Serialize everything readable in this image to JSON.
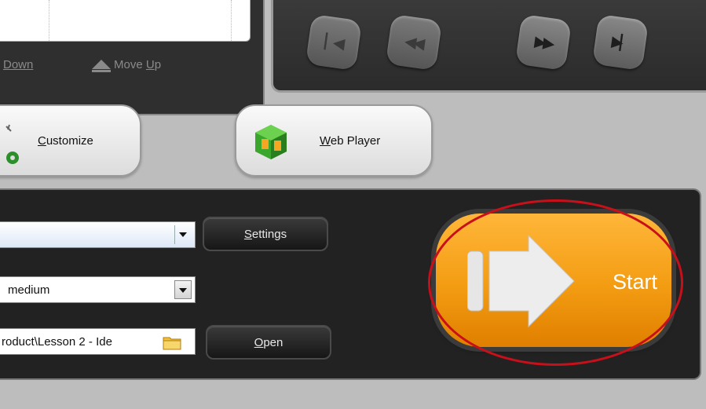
{
  "list_panel": {
    "move_down_label": "Down",
    "move_up_label_pre": "Move ",
    "move_up_label_key": "U",
    "move_up_label_post": "p"
  },
  "player": {
    "buttons": [
      "previous-track",
      "rewind",
      "fast-forward",
      "next-track"
    ]
  },
  "actions": {
    "customize_key": "C",
    "customize_rest": "ustomize",
    "web_player_key": "W",
    "web_player_rest": "eb Player"
  },
  "settings": {
    "format_value": "",
    "settings_key": "S",
    "settings_rest": "ettings",
    "quality_value": "medium",
    "output_path": "roduct\\Lesson 2 - Ide",
    "open_key": "O",
    "open_rest": "pen"
  },
  "start": {
    "label": "Start"
  },
  "colors": {
    "accent_orange": "#f39c12",
    "highlight_red": "#c8101a",
    "panel_dark": "#222222"
  }
}
